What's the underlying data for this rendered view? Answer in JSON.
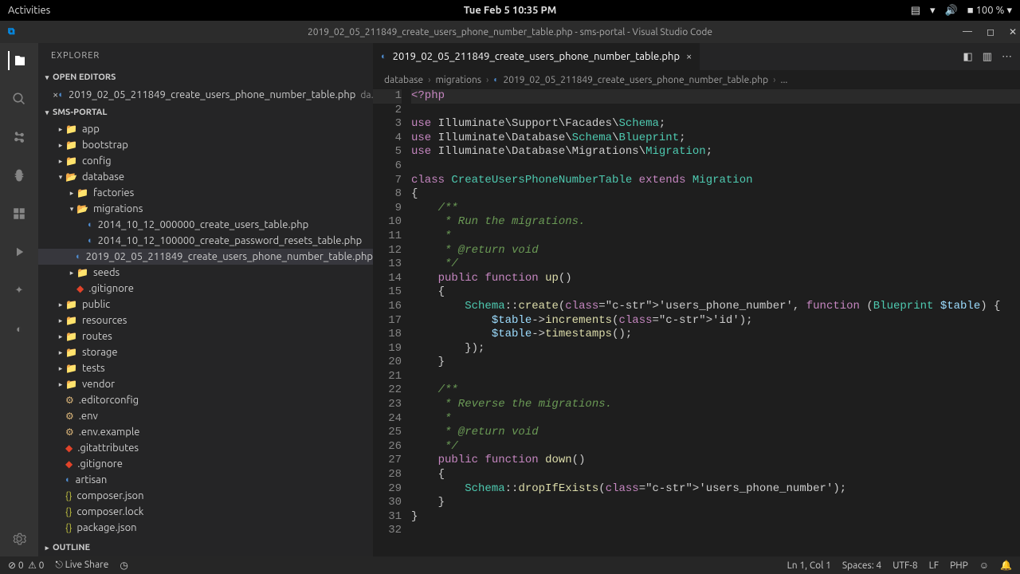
{
  "os": {
    "activities": "Activities",
    "clock": "Tue Feb 5  10:35 PM",
    "battery": "100 %"
  },
  "window": {
    "title": "2019_02_05_211849_create_users_phone_number_table.php - sms-portal - Visual Studio Code"
  },
  "explorer": {
    "title": "EXPLORER",
    "open_editors_label": "OPEN EDITORS",
    "open_editor_file": "2019_02_05_211849_create_users_phone_number_table.php",
    "open_editor_hint": "da...",
    "project_label": "SMS-PORTAL",
    "outline_label": "OUTLINE",
    "tree": [
      {
        "d": 1,
        "tw": "▸",
        "i": "fold",
        "n": "app"
      },
      {
        "d": 1,
        "tw": "▸",
        "i": "fold",
        "n": "bootstrap"
      },
      {
        "d": 1,
        "tw": "▸",
        "i": "fold",
        "n": "config"
      },
      {
        "d": 1,
        "tw": "▾",
        "i": "fold-open",
        "n": "database"
      },
      {
        "d": 2,
        "tw": "▸",
        "i": "fold",
        "n": "factories"
      },
      {
        "d": 2,
        "tw": "▾",
        "i": "fold-open",
        "n": "migrations"
      },
      {
        "d": 3,
        "tw": "",
        "i": "php",
        "n": "2014_10_12_000000_create_users_table.php"
      },
      {
        "d": 3,
        "tw": "",
        "i": "php",
        "n": "2014_10_12_100000_create_password_resets_table.php"
      },
      {
        "d": 3,
        "tw": "",
        "i": "php",
        "n": "2019_02_05_211849_create_users_phone_number_table.php",
        "sel": true
      },
      {
        "d": 2,
        "tw": "▸",
        "i": "fold",
        "n": "seeds"
      },
      {
        "d": 2,
        "tw": "",
        "i": "git",
        "n": ".gitignore"
      },
      {
        "d": 1,
        "tw": "▸",
        "i": "fold",
        "n": "public"
      },
      {
        "d": 1,
        "tw": "▸",
        "i": "fold",
        "n": "resources"
      },
      {
        "d": 1,
        "tw": "▸",
        "i": "fold",
        "n": "routes"
      },
      {
        "d": 1,
        "tw": "▸",
        "i": "fold",
        "n": "storage"
      },
      {
        "d": 1,
        "tw": "▸",
        "i": "fold",
        "n": "tests"
      },
      {
        "d": 1,
        "tw": "▸",
        "i": "fold",
        "n": "vendor"
      },
      {
        "d": 1,
        "tw": "",
        "i": "env",
        "n": ".editorconfig"
      },
      {
        "d": 1,
        "tw": "",
        "i": "env",
        "n": ".env"
      },
      {
        "d": 1,
        "tw": "",
        "i": "env",
        "n": ".env.example"
      },
      {
        "d": 1,
        "tw": "",
        "i": "git",
        "n": ".gitattributes"
      },
      {
        "d": 1,
        "tw": "",
        "i": "git",
        "n": ".gitignore"
      },
      {
        "d": 1,
        "tw": "",
        "i": "php",
        "n": "artisan"
      },
      {
        "d": 1,
        "tw": "",
        "i": "json",
        "n": "composer.json"
      },
      {
        "d": 1,
        "tw": "",
        "i": "json",
        "n": "composer.lock"
      },
      {
        "d": 1,
        "tw": "",
        "i": "json",
        "n": "package.json"
      }
    ]
  },
  "tab": {
    "name": "2019_02_05_211849_create_users_phone_number_table.php"
  },
  "breadcrumb": {
    "a": "database",
    "b": "migrations",
    "c": "2019_02_05_211849_create_users_phone_number_table.php",
    "d": "..."
  },
  "code_lines": [
    "<?php",
    "",
    "use Illuminate\\Support\\Facades\\Schema;",
    "use Illuminate\\Database\\Schema\\Blueprint;",
    "use Illuminate\\Database\\Migrations\\Migration;",
    "",
    "class CreateUsersPhoneNumberTable extends Migration",
    "{",
    "    /**",
    "     * Run the migrations.",
    "     *",
    "     * @return void",
    "     */",
    "    public function up()",
    "    {",
    "        Schema::create('users_phone_number', function (Blueprint $table) {",
    "            $table->increments('id');",
    "            $table->timestamps();",
    "        });",
    "    }",
    "",
    "    /**",
    "     * Reverse the migrations.",
    "     *",
    "     * @return void",
    "     */",
    "    public function down()",
    "    {",
    "        Schema::dropIfExists('users_phone_number');",
    "    }",
    "}",
    ""
  ],
  "status": {
    "errors": "0",
    "warnings": "0",
    "liveshare": "Live Share",
    "pos": "Ln 1, Col 1",
    "spaces": "Spaces: 4",
    "enc": "UTF-8",
    "eol": "LF",
    "lang": "PHP"
  }
}
